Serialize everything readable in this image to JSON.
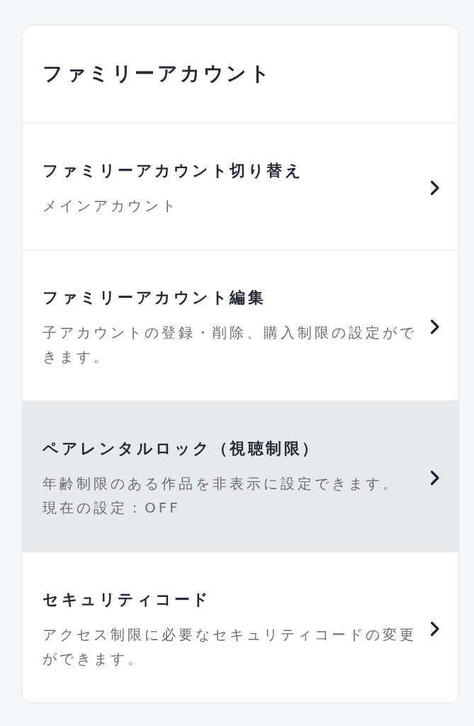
{
  "card": {
    "title": "ファミリーアカウント"
  },
  "items": [
    {
      "title": "ファミリーアカウント切り替え",
      "description": "メインアカウント",
      "selected": false
    },
    {
      "title": "ファミリーアカウント編集",
      "description": "子アカウントの登録・削除、購入制限の設定ができます。",
      "selected": false
    },
    {
      "title": "ペアレンタルロック（視聴制限）",
      "description": "年齢制限のある作品を非表示に設定できます。",
      "status": "現在の設定：OFF",
      "selected": true
    },
    {
      "title": "セキュリティコード",
      "description": "アクセス制限に必要なセキュリティコードの変更ができます。",
      "selected": false
    }
  ]
}
